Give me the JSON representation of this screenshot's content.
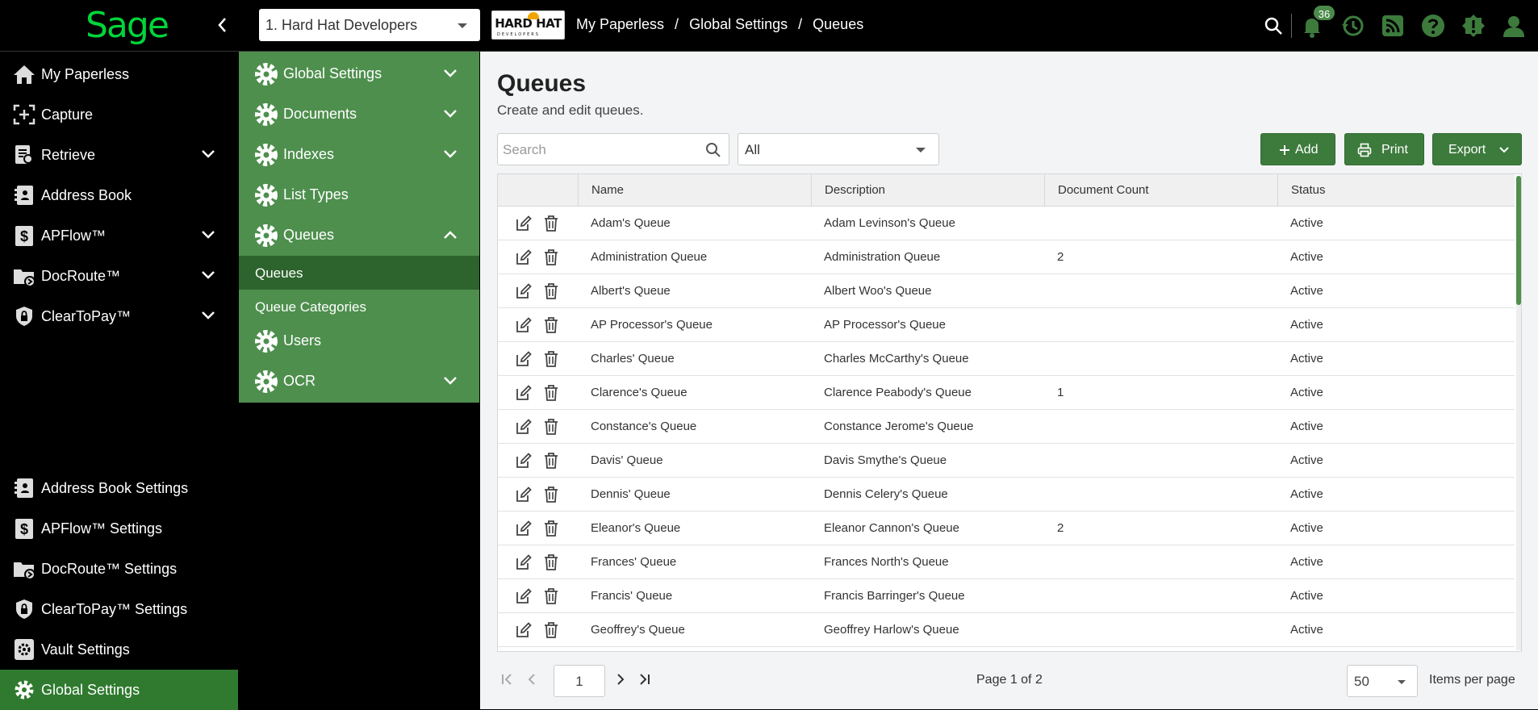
{
  "app": {
    "brand": "Sage"
  },
  "topbar": {
    "company": "1. Hard Hat Developers",
    "company_logo": "HARD HAT",
    "company_logo_sub": "DEVELOPERS",
    "breadcrumb": [
      "My Paperless",
      "Global Settings",
      "Queues"
    ],
    "notifications_count": "36"
  },
  "sidebar": {
    "items": [
      {
        "label": "My Paperless",
        "icon": "home-icon"
      },
      {
        "label": "Capture",
        "icon": "capture-icon"
      },
      {
        "label": "Retrieve",
        "icon": "retrieve-icon"
      },
      {
        "label": "Address Book",
        "icon": "address-book-icon"
      },
      {
        "label": "APFlow™",
        "icon": "dollar-doc-icon"
      },
      {
        "label": "DocRoute™",
        "icon": "folder-route-icon"
      },
      {
        "label": "ClearToPay™",
        "icon": "shield-lock-icon"
      }
    ],
    "settings": [
      {
        "label": "Address Book Settings"
      },
      {
        "label": "APFlow™ Settings"
      },
      {
        "label": "DocRoute™ Settings"
      },
      {
        "label": "ClearToPay™ Settings"
      },
      {
        "label": "Vault Settings"
      },
      {
        "label": "Global Settings"
      }
    ]
  },
  "submenu": {
    "items": [
      {
        "label": "Global Settings"
      },
      {
        "label": "Documents"
      },
      {
        "label": "Indexes"
      },
      {
        "label": "List Types"
      },
      {
        "label": "Queues"
      }
    ],
    "children": [
      {
        "label": "Queues"
      },
      {
        "label": "Queue Categories"
      }
    ],
    "after": [
      {
        "label": "Users"
      },
      {
        "label": "OCR"
      }
    ]
  },
  "page": {
    "title": "Queues",
    "subtitle": "Create and edit queues.",
    "search_placeholder": "Search",
    "filter_value": "All",
    "add_label": "Add",
    "print_label": "Print",
    "export_label": "Export"
  },
  "table": {
    "columns": [
      "Name",
      "Description",
      "Document Count",
      "Status"
    ],
    "rows": [
      {
        "name": "Adam's Queue",
        "description": "Adam Levinson's Queue",
        "count": "",
        "status": "Active"
      },
      {
        "name": "Administration Queue",
        "description": "Administration Queue",
        "count": "2",
        "status": "Active"
      },
      {
        "name": "Albert's Queue",
        "description": "Albert Woo's Queue",
        "count": "",
        "status": "Active"
      },
      {
        "name": "AP Processor's Queue",
        "description": "AP Processor's Queue",
        "count": "",
        "status": "Active"
      },
      {
        "name": "Charles' Queue",
        "description": "Charles McCarthy's Queue",
        "count": "",
        "status": "Active"
      },
      {
        "name": "Clarence's Queue",
        "description": "Clarence Peabody's Queue",
        "count": "1",
        "status": "Active"
      },
      {
        "name": "Constance's Queue",
        "description": "Constance Jerome's Queue",
        "count": "",
        "status": "Active"
      },
      {
        "name": "Davis' Queue",
        "description": "Davis Smythe's Queue",
        "count": "",
        "status": "Active"
      },
      {
        "name": "Dennis' Queue",
        "description": "Dennis Celery's Queue",
        "count": "",
        "status": "Active"
      },
      {
        "name": "Eleanor's Queue",
        "description": "Eleanor Cannon's Queue",
        "count": "2",
        "status": "Active"
      },
      {
        "name": "Frances' Queue",
        "description": "Frances North's Queue",
        "count": "",
        "status": "Active"
      },
      {
        "name": "Francis' Queue",
        "description": "Francis Barringer's Queue",
        "count": "",
        "status": "Active"
      },
      {
        "name": "Geoffrey's Queue",
        "description": "Geoffrey Harlow's Queue",
        "count": "",
        "status": "Active"
      }
    ]
  },
  "pager": {
    "page_input": "1",
    "info": "Page 1 of 2",
    "page_size": "50",
    "page_size_label": "Items per page"
  },
  "colors": {
    "accent": "#4e8f4e",
    "accent_dark": "#2d632d",
    "brand": "#00d639"
  }
}
